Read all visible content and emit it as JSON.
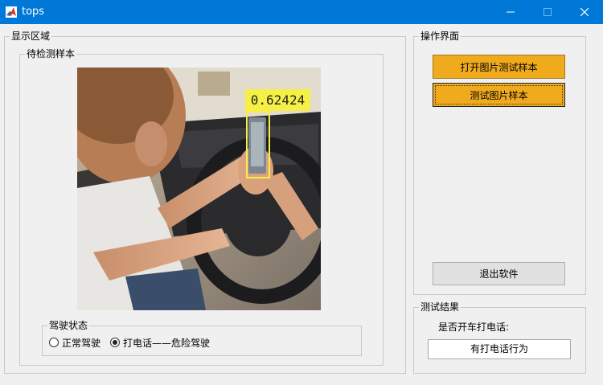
{
  "window": {
    "title": "tops",
    "minimize_glyph": "—",
    "maximize_glyph": "☐",
    "close_glyph": "✕"
  },
  "display_panel": {
    "title": "显示区域",
    "sample_panel": {
      "title": "待检测样本",
      "detection": {
        "score_label": "0.62424",
        "box_color": "#f5ef46"
      }
    },
    "driving_state": {
      "title": "驾驶状态",
      "options": [
        {
          "label": "正常驾驶",
          "checked": false
        },
        {
          "label": "打电话——危险驾驶",
          "checked": true
        }
      ]
    }
  },
  "ops_panel": {
    "title": "操作界面",
    "open_button": "打开图片测试样本",
    "test_button": "测试图片样本",
    "exit_button": "退出软件"
  },
  "result_panel": {
    "title": "测试结果",
    "question": "是否开车打电话:",
    "answer": "有打电话行为"
  },
  "colors": {
    "titlebar": "#0078d7",
    "button_accent": "#f0aa1e"
  }
}
